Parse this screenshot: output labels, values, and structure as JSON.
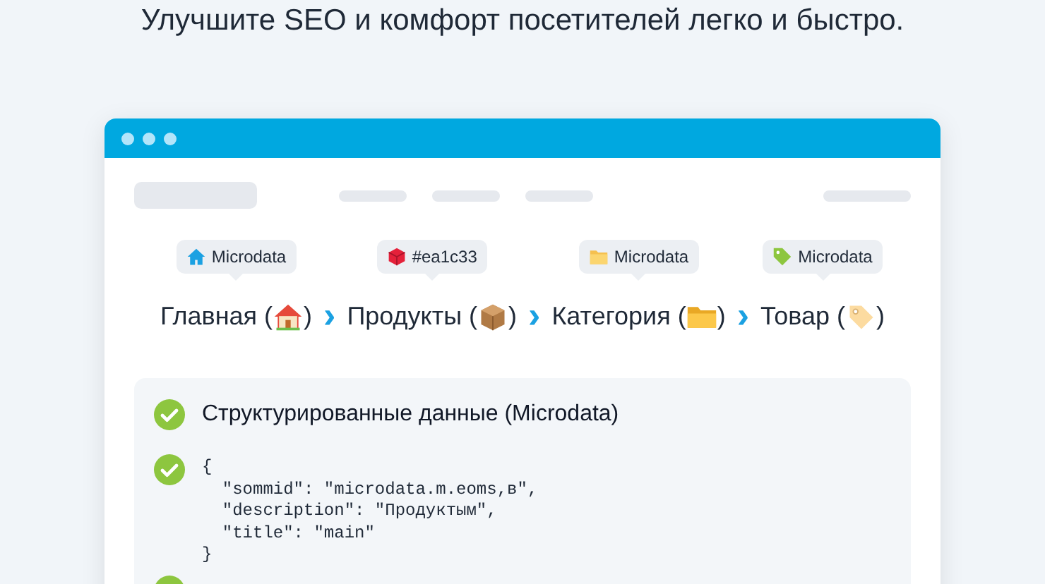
{
  "headline": "Улучшите SEO и комфорт посетителей легко и быстро.",
  "breadcrumb": [
    {
      "badge": "Microdata",
      "text": "Главная (",
      "close": ")"
    },
    {
      "badge": "#ea1c33",
      "text": "Продукты (",
      "close": ")"
    },
    {
      "badge": "Microdata",
      "text": "Категория (",
      "close": ")"
    },
    {
      "badge": "Microdata",
      "text": "Товар (",
      "close": ")"
    }
  ],
  "separator": "›",
  "panel": {
    "title": "Структурированные данные (Microdata)",
    "code": [
      "{",
      "  \"sommid\": \"microdata.m.eoms,в\",",
      "  \"description\": \"Продуктым\",",
      "  \"title\": \"main\"",
      "}"
    ]
  }
}
